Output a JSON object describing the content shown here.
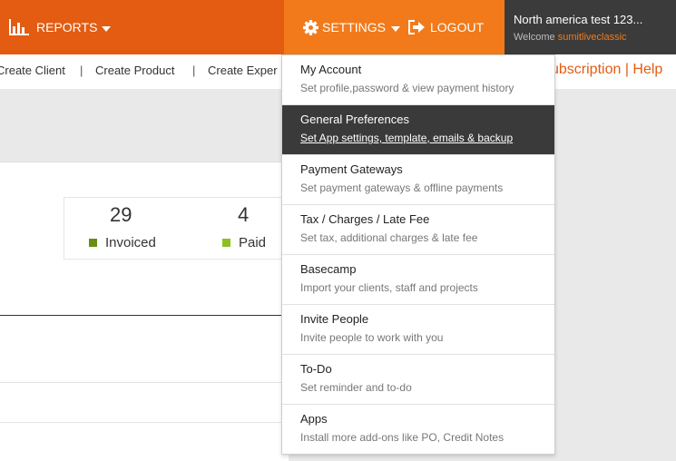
{
  "colors": {
    "brand_orange": "#e35c11",
    "settings_orange": "#f27a1a",
    "dark": "#3b3b3b",
    "invoiced_green": "#6a8e12",
    "paid_green": "#8dbf21"
  },
  "header": {
    "reports_label": "REPORTS",
    "reports_icon": "bar-chart-icon",
    "settings_label": "SETTINGS",
    "settings_icon": "gear-icon",
    "logout_label": "LOGOUT",
    "logout_icon": "logout-icon",
    "account_name": "North america test 123...",
    "welcome_text": "Welcome",
    "username": "sumitliveclassic"
  },
  "subnav": {
    "links": [
      "Create Client",
      "Create Product",
      "Create Exper"
    ],
    "right": "ubscription | Help"
  },
  "stats": {
    "invoiced": {
      "count": "29",
      "label": "Invoiced"
    },
    "paid": {
      "count": "4",
      "label": "Paid"
    }
  },
  "settings_menu": [
    {
      "title": "My Account",
      "desc": "Set profile,password & view payment history"
    },
    {
      "title": "General Preferences",
      "desc": "Set App settings, template, emails & backup"
    },
    {
      "title": "Payment Gateways",
      "desc": "Set payment gateways & offline payments"
    },
    {
      "title": "Tax / Charges / Late Fee",
      "desc": "Set tax, additional charges & late fee"
    },
    {
      "title": "Basecamp",
      "desc": "Import your clients, staff and projects"
    },
    {
      "title": "Invite People",
      "desc": "Invite people to work with you"
    },
    {
      "title": "To-Do",
      "desc": "Set reminder and to-do"
    },
    {
      "title": "Apps",
      "desc": "Install more add-ons like PO, Credit Notes"
    }
  ]
}
